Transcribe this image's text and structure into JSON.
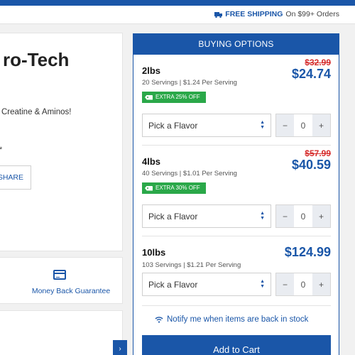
{
  "header": {
    "shipping_strong": "FREE SHIPPING",
    "shipping_rest": "On $99+ Orders"
  },
  "product": {
    "title_partial": "ro-Tech",
    "description_partial": "Creatine & Aminos!",
    "asterisk": "*",
    "share_label": "SHARE"
  },
  "features": {
    "money_back": "Money Back Guarantee"
  },
  "carousel": {
    "next_label": "›"
  },
  "buying": {
    "heading": "BUYING OPTIONS",
    "options": [
      {
        "name": "2lbs",
        "servings": "20 Servings | $1.24 Per Serving",
        "old_price": "$32.99",
        "price": "$24.74",
        "badge": "EXTRA 25% OFF",
        "flavor_placeholder": "Pick a Flavor",
        "qty": "0"
      },
      {
        "name": "4lbs",
        "servings": "40 Servings | $1.01 Per Serving",
        "old_price": "$57.99",
        "price": "$40.59",
        "badge": "EXTRA 30% OFF",
        "flavor_placeholder": "Pick a Flavor",
        "qty": "0"
      },
      {
        "name": "10lbs",
        "servings": "103 Servings | $1.21 Per Serving",
        "old_price": "",
        "price": "$124.99",
        "badge": "",
        "flavor_placeholder": "Pick a Flavor",
        "qty": "0"
      }
    ],
    "stepper_minus": "−",
    "stepper_plus": "+",
    "notify_label": "Notify me when items are back in stock",
    "add_to_cart": "Add to Cart"
  },
  "colors": {
    "brand_blue": "#1a56a8",
    "sale_red": "#d62e2e",
    "discount_green": "#2aa849"
  },
  "icons": [
    "truck-icon",
    "tag-icon",
    "credit-card-icon",
    "wifi-icon",
    "chevron-right-icon",
    "sort-arrows-icon"
  ]
}
